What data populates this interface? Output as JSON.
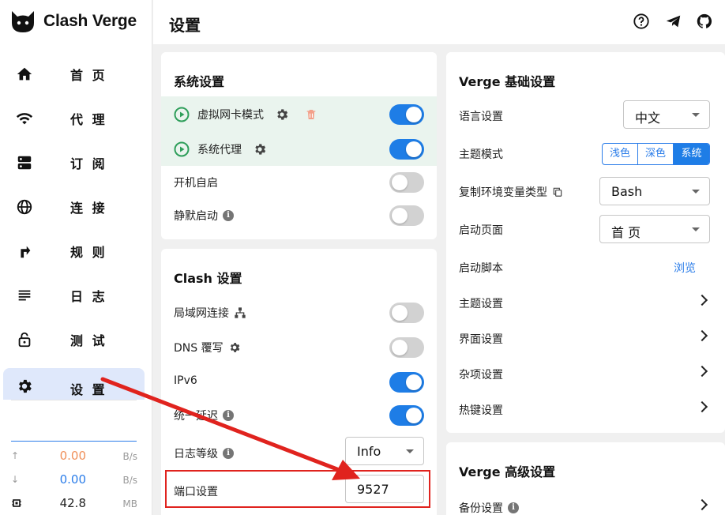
{
  "app": {
    "name": "Clash Verge"
  },
  "sidebar": {
    "items": [
      {
        "label": "首 页",
        "icon": "home-icon"
      },
      {
        "label": "代 理",
        "icon": "wifi-icon"
      },
      {
        "label": "订 阅",
        "icon": "dns-icon"
      },
      {
        "label": "连 接",
        "icon": "globe-icon"
      },
      {
        "label": "规 则",
        "icon": "forward-arrow-icon"
      },
      {
        "label": "日 志",
        "icon": "list-icon"
      },
      {
        "label": "测 试",
        "icon": "lock-icon"
      },
      {
        "label": "设 置",
        "icon": "gear-icon",
        "active": true
      }
    ],
    "traffic": {
      "up": {
        "value": "0.00",
        "unit": "B/s",
        "color": "#f0905a"
      },
      "down": {
        "value": "0.00",
        "unit": "B/s",
        "color": "#2b7de9"
      },
      "memory": {
        "value": "42.8",
        "unit": "MB"
      }
    }
  },
  "header": {
    "title": "设置",
    "icons": [
      "help-icon",
      "telegram-icon",
      "github-icon"
    ]
  },
  "system": {
    "title": "系统设置",
    "rows": [
      {
        "label": "虚拟网卡模式",
        "on": true
      },
      {
        "label": "系统代理",
        "on": true
      },
      {
        "label": "开机自启",
        "on": false
      },
      {
        "label": "静默启动",
        "on": false
      }
    ]
  },
  "clash": {
    "title": "Clash 设置",
    "rows": [
      {
        "label": "局域网连接",
        "on": false
      },
      {
        "label": "DNS 覆写",
        "on": false
      },
      {
        "label": "IPv6",
        "on": true
      },
      {
        "label": "统一延迟",
        "on": true
      }
    ],
    "log_level": {
      "label": "日志等级",
      "value": "Info"
    },
    "port": {
      "label": "端口设置",
      "value": "9527"
    }
  },
  "verge_basic": {
    "title": "Verge 基础设置",
    "language": {
      "label": "语言设置",
      "value": "中文"
    },
    "theme_mode": {
      "label": "主题模式",
      "options": [
        "浅色",
        "深色",
        "系统"
      ],
      "selected": "系统"
    },
    "env_type": {
      "label": "复制环境变量类型",
      "value": "Bash"
    },
    "start_page": {
      "label": "启动页面",
      "value": "首 页"
    },
    "start_script": {
      "label": "启动脚本",
      "action": "浏览"
    },
    "nav_rows": [
      "主题设置",
      "界面设置",
      "杂项设置",
      "热键设置"
    ]
  },
  "verge_advanced": {
    "title": "Verge 高级设置",
    "backup": {
      "label": "备份设置"
    }
  },
  "colors": {
    "accent": "#1e7de6",
    "annotation": "#e0231e",
    "highlight_row": "#eaf4ee"
  }
}
